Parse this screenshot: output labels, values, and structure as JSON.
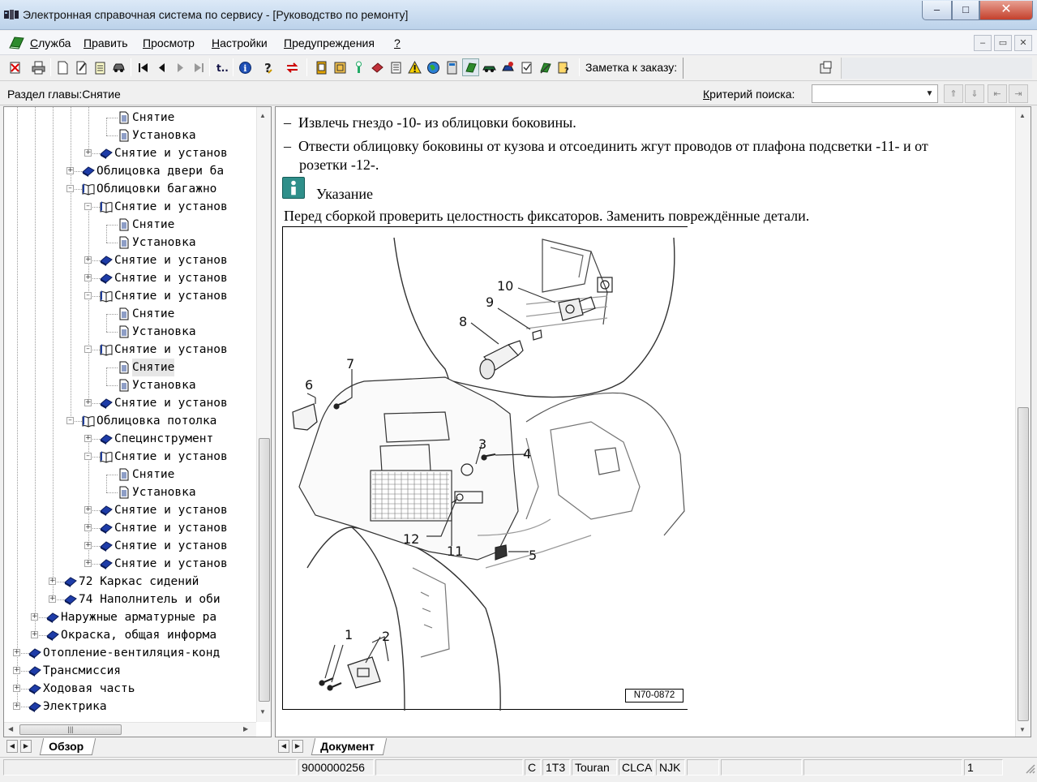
{
  "window": {
    "title": "Электронная справочная система по сервису - [Руководство по ремонту]",
    "minimize": "–",
    "maximize": "□",
    "close": "✕"
  },
  "menu": {
    "items": [
      {
        "hot": "С",
        "rest": "лужба"
      },
      {
        "hot": "П",
        "rest": "равить"
      },
      {
        "hot": "П",
        "rest": "росмотр"
      },
      {
        "hot": "Н",
        "rest": "астройки"
      },
      {
        "hot": "П",
        "rest": "редупреждения"
      },
      {
        "hot": "?",
        "rest": ""
      }
    ],
    "mdi": {
      "minimize": "–",
      "restore": "▭",
      "close": "✕"
    }
  },
  "toolbar": {
    "order_note_label": "Заметка к заказу:"
  },
  "searchbar": {
    "section_label": "Раздел главы:Снятие",
    "criteria_hot": "К",
    "criteria_rest": "ритерий  поиска:",
    "criteria_value": ""
  },
  "tree": {
    "nodes": [
      {
        "level": 6,
        "kind": "page",
        "label": "Снятие"
      },
      {
        "level": 6,
        "kind": "page",
        "label": "Установка"
      },
      {
        "level": 5,
        "kind": "closed",
        "exp": "+",
        "label": "Снятие и установ"
      },
      {
        "level": 4,
        "kind": "closed",
        "exp": "+",
        "label": "Облицовка двери ба"
      },
      {
        "level": 4,
        "kind": "open",
        "exp": "–",
        "label": "Облицовки багажно"
      },
      {
        "level": 5,
        "kind": "open",
        "exp": "–",
        "label": "Снятие и установ"
      },
      {
        "level": 6,
        "kind": "page",
        "label": "Снятие"
      },
      {
        "level": 6,
        "kind": "page",
        "label": "Установка"
      },
      {
        "level": 5,
        "kind": "closed",
        "exp": "+",
        "label": "Снятие и установ"
      },
      {
        "level": 5,
        "kind": "closed",
        "exp": "+",
        "label": "Снятие и установ"
      },
      {
        "level": 5,
        "kind": "open",
        "exp": "–",
        "label": "Снятие и установ"
      },
      {
        "level": 6,
        "kind": "page",
        "label": "Снятие"
      },
      {
        "level": 6,
        "kind": "page",
        "label": "Установка"
      },
      {
        "level": 5,
        "kind": "open",
        "exp": "–",
        "label": "Снятие и установ"
      },
      {
        "level": 6,
        "kind": "page",
        "label": "Снятие",
        "selected": true
      },
      {
        "level": 6,
        "kind": "page",
        "label": "Установка"
      },
      {
        "level": 5,
        "kind": "closed",
        "exp": "+",
        "label": "Снятие и установ"
      },
      {
        "level": 4,
        "kind": "open",
        "exp": "–",
        "label": "Облицовка потолка"
      },
      {
        "level": 5,
        "kind": "closed",
        "exp": "+",
        "label": "Специнструмент"
      },
      {
        "level": 5,
        "kind": "open",
        "exp": "–",
        "label": "Снятие и установ"
      },
      {
        "level": 6,
        "kind": "page",
        "label": "Снятие"
      },
      {
        "level": 6,
        "kind": "page",
        "label": "Установка"
      },
      {
        "level": 5,
        "kind": "closed",
        "exp": "+",
        "label": "Снятие и установ"
      },
      {
        "level": 5,
        "kind": "closed",
        "exp": "+",
        "label": "Снятие и установ"
      },
      {
        "level": 5,
        "kind": "closed",
        "exp": "+",
        "label": "Снятие и установ"
      },
      {
        "level": 5,
        "kind": "closed",
        "exp": "+",
        "label": "Снятие и установ"
      },
      {
        "level": 3,
        "kind": "closed",
        "exp": "+",
        "label": "72 Каркас сидений"
      },
      {
        "level": 3,
        "kind": "closed",
        "exp": "+",
        "label": "74 Наполнитель и оби"
      },
      {
        "level": 2,
        "kind": "closed",
        "exp": "+",
        "label": "Наружные арматурные ра"
      },
      {
        "level": 2,
        "kind": "closed",
        "exp": "+",
        "label": "Окраска, общая информа"
      },
      {
        "level": 1,
        "kind": "closed",
        "exp": "+",
        "label": "Отопление-вентиляция-конд"
      },
      {
        "level": 1,
        "kind": "closed",
        "exp": "+",
        "label": "Трансмиссия"
      },
      {
        "level": 1,
        "kind": "closed",
        "exp": "+",
        "label": "Ходовая часть"
      },
      {
        "level": 1,
        "kind": "closed",
        "exp": "+",
        "label": "Электрика"
      }
    ]
  },
  "document": {
    "bullet_dash": "–",
    "steps": [
      "Извлечь гнездо -10- из облицовки боковины.",
      "Отвести облицовку боковины от кузова и отсоединить жгут проводов от плафона подсветки -11- и от",
      "розетки -12-."
    ],
    "note_icon": "i",
    "note_label": "Указание",
    "note_text": "Перед сборкой проверить целостность фиксаторов. Заменить повреждённые детали.",
    "figure": {
      "code": "N70-0872",
      "labels": [
        "1",
        "2",
        "3",
        "4",
        "5",
        "6",
        "7",
        "8",
        "9",
        "10",
        "11",
        "12"
      ]
    }
  },
  "tabs": {
    "left": {
      "label": "Обзор"
    },
    "right": {
      "label": "Документ"
    },
    "prev": "◀",
    "next": "▶"
  },
  "status": {
    "number": "9000000256",
    "c": "C",
    "model_code": "1T3",
    "model": "Touran",
    "engine": "CLCA",
    "gear": "NJK",
    "page": "1"
  }
}
